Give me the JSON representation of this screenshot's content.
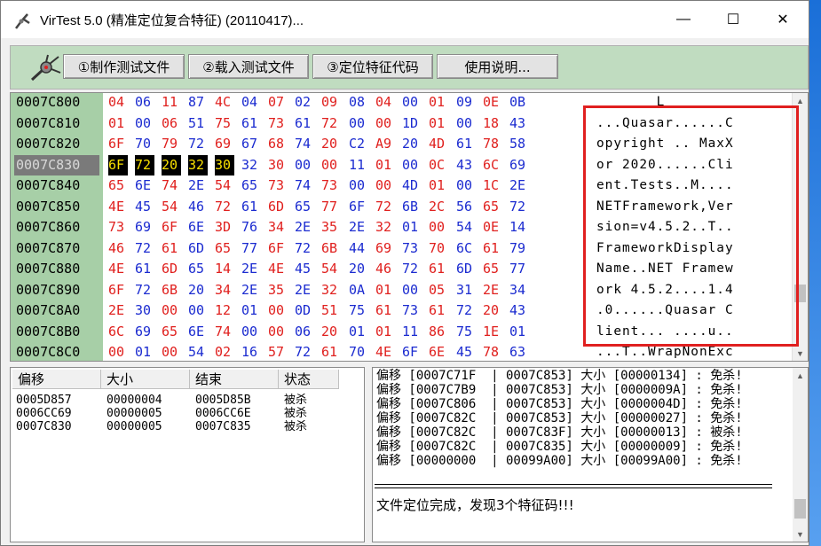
{
  "window": {
    "title": "VirTest 5.0 (精准定位复合特征) (20110417)...",
    "minimize": "—",
    "maximize": "☐",
    "close": "✕"
  },
  "toolbar": {
    "make_file": "①制作测试文件",
    "load_file": "②载入测试文件",
    "locate_code": "③定位特征代码",
    "help": "使用说明..."
  },
  "hex": {
    "rows": [
      {
        "addr": "0007C800",
        "bytes": [
          "04",
          "06",
          "11",
          "87",
          "4C",
          "04",
          "07",
          "02",
          "09",
          "08",
          "04",
          "00",
          "01",
          "09",
          "0E",
          "0B"
        ],
        "ascii": "       L"
      },
      {
        "addr": "0007C810",
        "bytes": [
          "01",
          "00",
          "06",
          "51",
          "75",
          "61",
          "73",
          "61",
          "72",
          "00",
          "00",
          "1D",
          "01",
          "00",
          "18",
          "43"
        ],
        "ascii": "...Quasar......C"
      },
      {
        "addr": "0007C820",
        "bytes": [
          "6F",
          "70",
          "79",
          "72",
          "69",
          "67",
          "68",
          "74",
          "20",
          "C2",
          "A9",
          "20",
          "4D",
          "61",
          "78",
          "58"
        ],
        "ascii": "opyright .. MaxX"
      },
      {
        "addr": "0007C830",
        "bytes": [
          "6F",
          "72",
          "20",
          "32",
          "30",
          "32",
          "30",
          "00",
          "00",
          "11",
          "01",
          "00",
          "0C",
          "43",
          "6C",
          "69"
        ],
        "ascii": "or 2020......Cli"
      },
      {
        "addr": "0007C840",
        "bytes": [
          "65",
          "6E",
          "74",
          "2E",
          "54",
          "65",
          "73",
          "74",
          "73",
          "00",
          "00",
          "4D",
          "01",
          "00",
          "1C",
          "2E"
        ],
        "ascii": "ent.Tests..M...."
      },
      {
        "addr": "0007C850",
        "bytes": [
          "4E",
          "45",
          "54",
          "46",
          "72",
          "61",
          "6D",
          "65",
          "77",
          "6F",
          "72",
          "6B",
          "2C",
          "56",
          "65",
          "72"
        ],
        "ascii": "NETFramework,Ver"
      },
      {
        "addr": "0007C860",
        "bytes": [
          "73",
          "69",
          "6F",
          "6E",
          "3D",
          "76",
          "34",
          "2E",
          "35",
          "2E",
          "32",
          "01",
          "00",
          "54",
          "0E",
          "14"
        ],
        "ascii": "sion=v4.5.2..T.."
      },
      {
        "addr": "0007C870",
        "bytes": [
          "46",
          "72",
          "61",
          "6D",
          "65",
          "77",
          "6F",
          "72",
          "6B",
          "44",
          "69",
          "73",
          "70",
          "6C",
          "61",
          "79"
        ],
        "ascii": "FrameworkDisplay"
      },
      {
        "addr": "0007C880",
        "bytes": [
          "4E",
          "61",
          "6D",
          "65",
          "14",
          "2E",
          "4E",
          "45",
          "54",
          "20",
          "46",
          "72",
          "61",
          "6D",
          "65",
          "77"
        ],
        "ascii": "Name..NET Framew"
      },
      {
        "addr": "0007C890",
        "bytes": [
          "6F",
          "72",
          "6B",
          "20",
          "34",
          "2E",
          "35",
          "2E",
          "32",
          "0A",
          "01",
          "00",
          "05",
          "31",
          "2E",
          "34"
        ],
        "ascii": "ork 4.5.2....1.4"
      },
      {
        "addr": "0007C8A0",
        "bytes": [
          "2E",
          "30",
          "00",
          "00",
          "12",
          "01",
          "00",
          "0D",
          "51",
          "75",
          "61",
          "73",
          "61",
          "72",
          "20",
          "43"
        ],
        "ascii": ".0......Quasar C"
      },
      {
        "addr": "0007C8B0",
        "bytes": [
          "6C",
          "69",
          "65",
          "6E",
          "74",
          "00",
          "00",
          "06",
          "20",
          "01",
          "01",
          "11",
          "86",
          "75",
          "1E",
          "01"
        ],
        "ascii": "lient... ....u.."
      },
      {
        "addr": "0007C8C0",
        "bytes": [
          "00",
          "01",
          "00",
          "54",
          "02",
          "16",
          "57",
          "72",
          "61",
          "70",
          "4E",
          "6F",
          "6E",
          "45",
          "78",
          "63"
        ],
        "ascii": "...T..WrapNonExc"
      }
    ]
  },
  "list": {
    "headers": [
      "偏移",
      "大小",
      "结束",
      "状态"
    ],
    "rows": [
      {
        "offset": "0005D857",
        "size": "00000004",
        "end": "0005D85B",
        "status": "被杀"
      },
      {
        "offset": "0006CC69",
        "size": "00000005",
        "end": "0006CC6E",
        "status": "被杀"
      },
      {
        "offset": "0007C830",
        "size": "00000005",
        "end": "0007C835",
        "status": "被杀"
      }
    ]
  },
  "log": {
    "lines": [
      "偏移 [0007C71F  | 0007C853] 大小 [00000134] : 免杀!",
      "偏移 [0007C7B9  | 0007C853] 大小 [0000009A] : 免杀!",
      "偏移 [0007C806  | 0007C853] 大小 [0000004D] : 免杀!",
      "偏移 [0007C82C  | 0007C853] 大小 [00000027] : 免杀!",
      "偏移 [0007C82C  | 0007C83F] 大小 [00000013] : 被杀!",
      "偏移 [0007C82C  | 0007C835] 大小 [00000009] : 免杀!",
      "偏移 [00000000  | 00099A00] 大小 [00099A00] : 免杀!"
    ],
    "status": "文件定位完成，发现3个特征码!!!"
  }
}
